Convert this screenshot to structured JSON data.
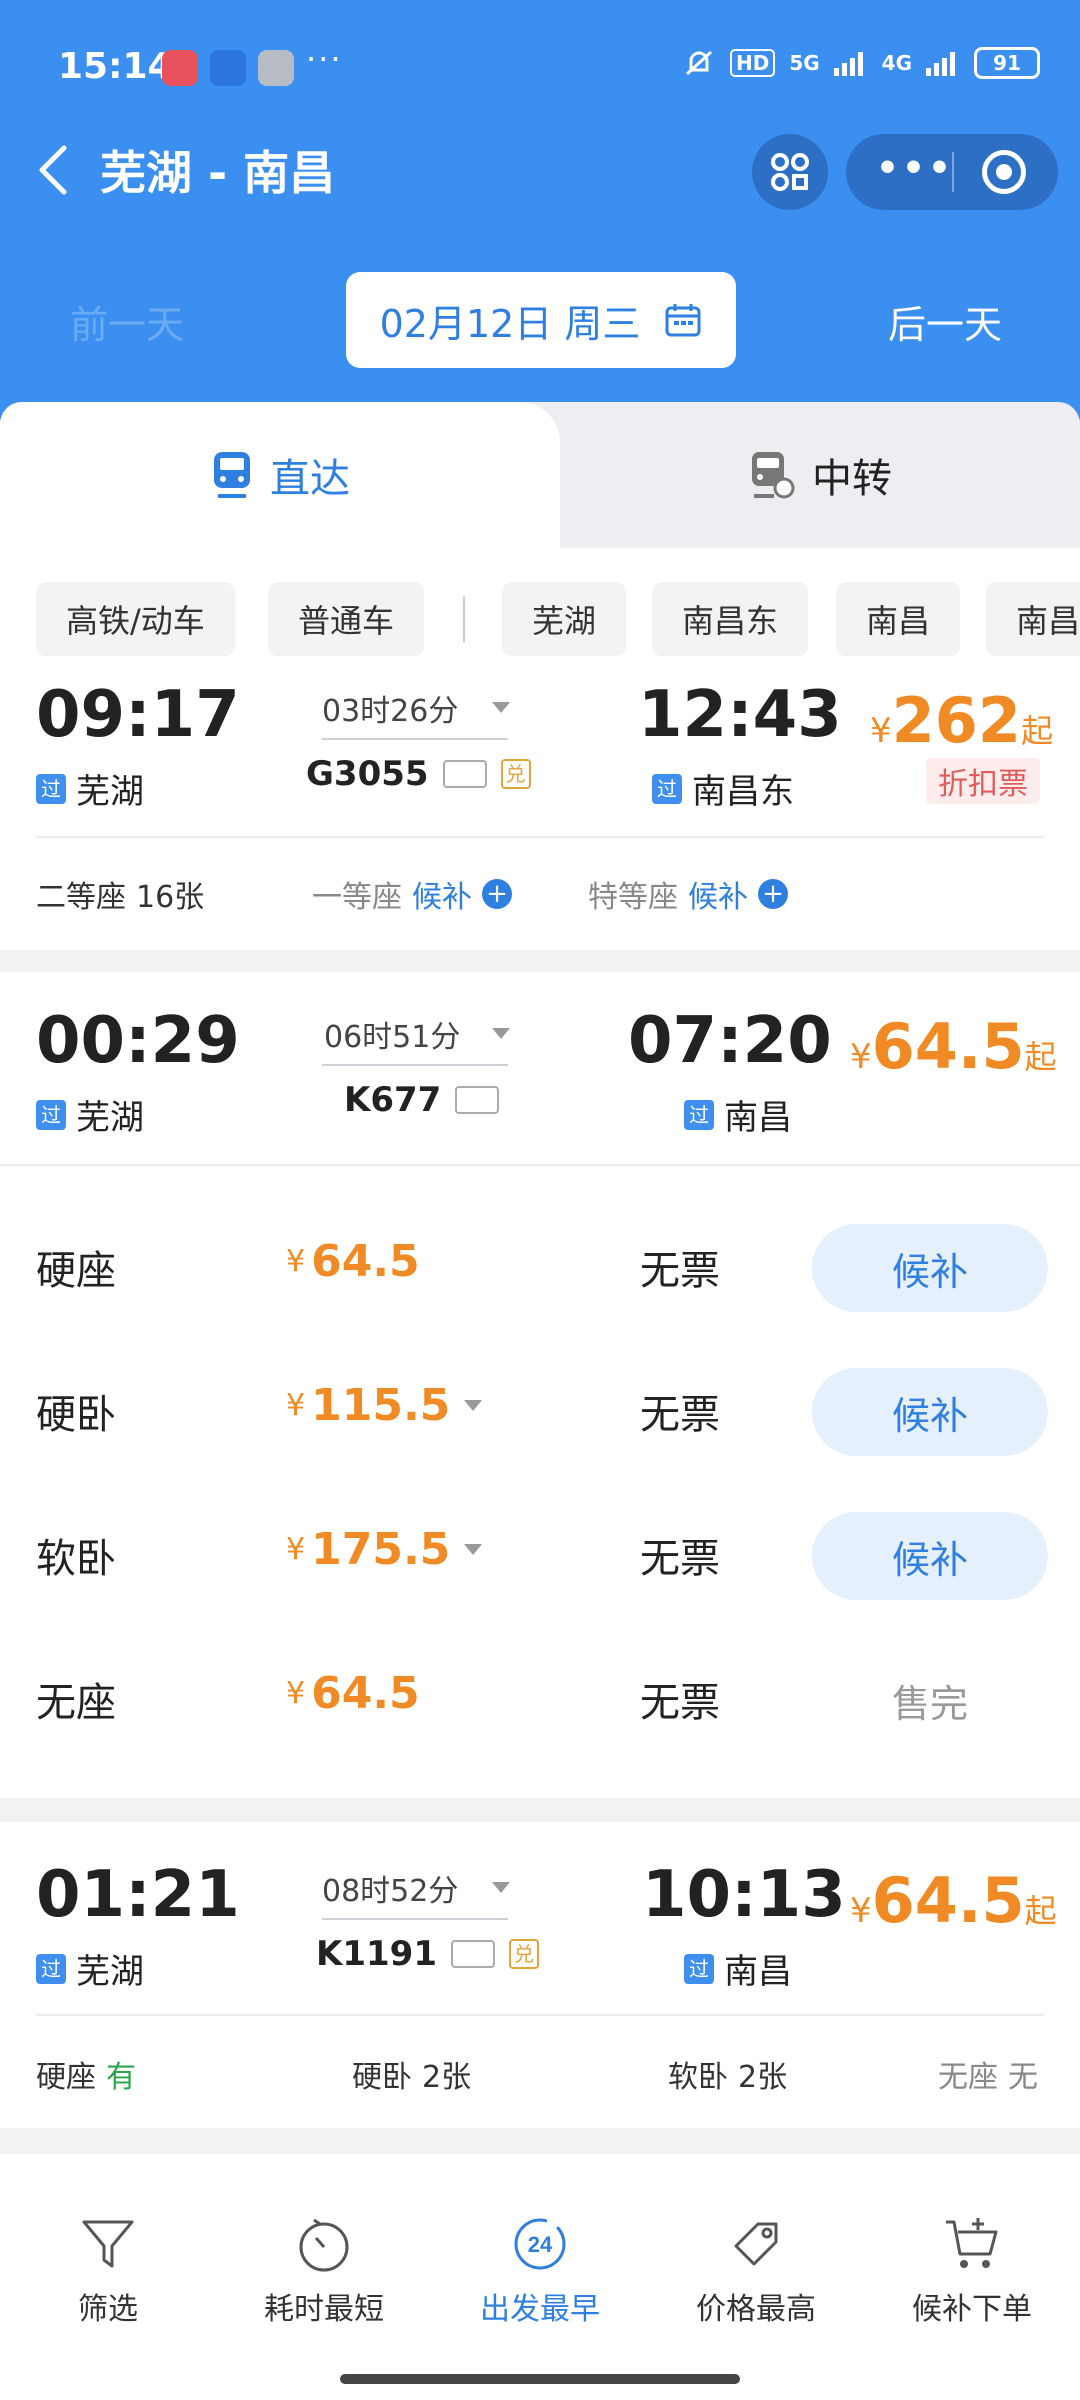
{
  "status_bar": {
    "time": "15:14",
    "more": "···",
    "hd_badge": "HD",
    "signal_5g": "5G",
    "signal_4g": "4G",
    "battery": "91"
  },
  "nav": {
    "title": "芜湖 - 南昌",
    "more": "•••"
  },
  "date_bar": {
    "prev_day": "前一天",
    "date": "02月12日 周三",
    "next_day": "后一天"
  },
  "tabs": [
    {
      "label": "直达",
      "active": true
    },
    {
      "label": "中转",
      "active": false
    }
  ],
  "filters": [
    "高铁/动车",
    "普通车",
    "芜湖",
    "南昌东",
    "南昌",
    "南昌西"
  ],
  "trains": [
    {
      "depart_time": "09:17",
      "depart_station": "芜湖",
      "duration": "03时26分",
      "train_no": "G3055",
      "arrive_time": "12:43",
      "arrive_station": "南昌东",
      "price_symbol": "¥",
      "price": "262",
      "price_suffix": "起",
      "discount": "折扣票",
      "pass_badge": "过",
      "dui_badge": "兑",
      "seats": [
        {
          "name": "二等座",
          "avail": "16张"
        },
        {
          "name": "一等座",
          "avail": "候补"
        },
        {
          "name": "特等座",
          "avail": "候补"
        }
      ]
    },
    {
      "depart_time": "00:29",
      "depart_station": "芜湖",
      "duration": "06时51分",
      "train_no": "K677",
      "arrive_time": "07:20",
      "arrive_station": "南昌",
      "price_symbol": "¥",
      "price": "64.5",
      "price_suffix": "起",
      "pass_badge": "过",
      "seat_rows": [
        {
          "name": "硬座",
          "price": "64.5",
          "status": "无票",
          "action": "候补"
        },
        {
          "name": "硬卧",
          "price": "115.5",
          "status": "无票",
          "action": "候补"
        },
        {
          "name": "软卧",
          "price": "175.5",
          "status": "无票",
          "action": "候补"
        },
        {
          "name": "无座",
          "price": "64.5",
          "status": "无票",
          "action": "售完"
        }
      ]
    },
    {
      "depart_time": "01:21",
      "depart_station": "芜湖",
      "duration": "08时52分",
      "train_no": "K1191",
      "arrive_time": "10:13",
      "arrive_station": "南昌",
      "price_symbol": "¥",
      "price": "64.5",
      "price_suffix": "起",
      "pass_badge": "过",
      "dui_badge": "兑",
      "seats": [
        {
          "name": "硬座",
          "avail": "有"
        },
        {
          "name": "硬卧",
          "avail": "2张"
        },
        {
          "name": "软卧",
          "avail": "2张"
        },
        {
          "name": "无座",
          "avail": "无"
        }
      ]
    }
  ],
  "bottom_bar": [
    {
      "label": "筛选",
      "icon": "filter-icon",
      "active": false
    },
    {
      "label": "耗时最短",
      "icon": "stopwatch-icon",
      "active": false
    },
    {
      "label": "出发最早",
      "icon": "24h-icon",
      "active": true,
      "icon_text": "24"
    },
    {
      "label": "价格最高",
      "icon": "price-tag-icon",
      "active": false
    },
    {
      "label": "候补下单",
      "icon": "cart-icon",
      "active": false
    }
  ],
  "colors": {
    "brand_blue": "#3a8ff0",
    "price_orange": "#f08a24",
    "discount_red": "#e25b5b"
  }
}
